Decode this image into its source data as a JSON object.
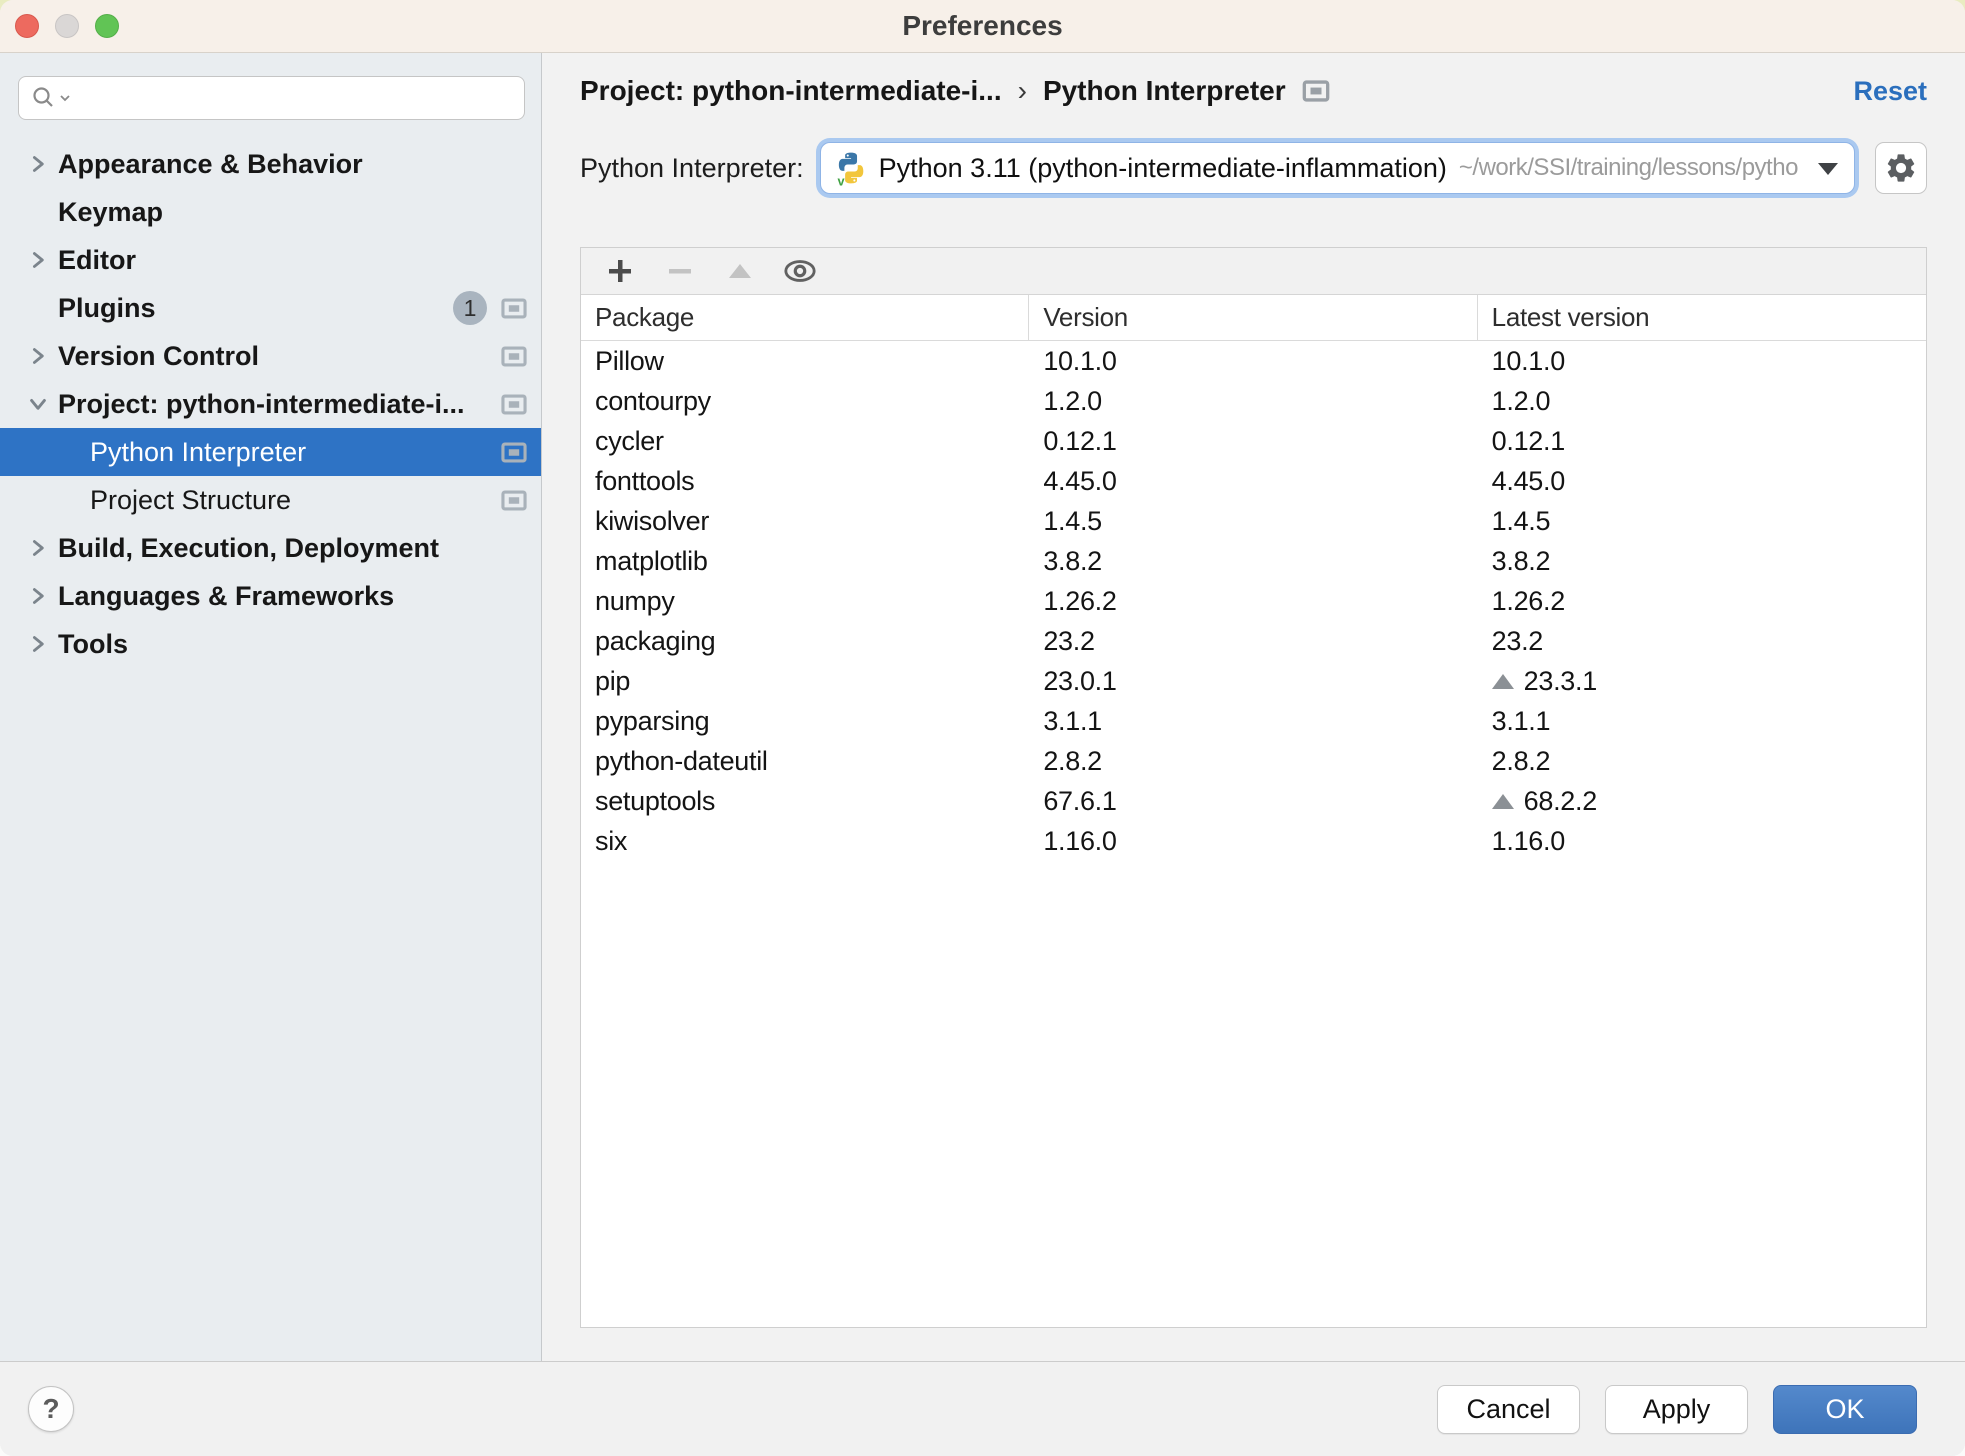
{
  "window": {
    "title": "Preferences"
  },
  "sidebar": {
    "search": {
      "placeholder": ""
    },
    "items": [
      {
        "label": "Appearance & Behavior",
        "chevron": "right",
        "level": 0,
        "bold": true,
        "selected": false,
        "badge": null,
        "marker": false
      },
      {
        "label": "Keymap",
        "chevron": "none",
        "level": 0,
        "bold": true,
        "selected": false,
        "badge": null,
        "marker": false
      },
      {
        "label": "Editor",
        "chevron": "right",
        "level": 0,
        "bold": true,
        "selected": false,
        "badge": null,
        "marker": false
      },
      {
        "label": "Plugins",
        "chevron": "none",
        "level": 0,
        "bold": true,
        "selected": false,
        "badge": "1",
        "marker": true
      },
      {
        "label": "Version Control",
        "chevron": "right",
        "level": 0,
        "bold": true,
        "selected": false,
        "badge": null,
        "marker": true
      },
      {
        "label": "Project: python-intermediate-i...",
        "chevron": "down",
        "level": 0,
        "bold": true,
        "selected": false,
        "badge": null,
        "marker": true
      },
      {
        "label": "Python Interpreter",
        "chevron": "none",
        "level": 1,
        "bold": false,
        "selected": true,
        "badge": null,
        "marker": true
      },
      {
        "label": "Project Structure",
        "chevron": "none",
        "level": 1,
        "bold": false,
        "selected": false,
        "badge": null,
        "marker": true
      },
      {
        "label": "Build, Execution, Deployment",
        "chevron": "right",
        "level": 0,
        "bold": true,
        "selected": false,
        "badge": null,
        "marker": false
      },
      {
        "label": "Languages & Frameworks",
        "chevron": "right",
        "level": 0,
        "bold": true,
        "selected": false,
        "badge": null,
        "marker": false
      },
      {
        "label": "Tools",
        "chevron": "right",
        "level": 0,
        "bold": true,
        "selected": false,
        "badge": null,
        "marker": false
      }
    ]
  },
  "header": {
    "breadcrumb_project": "Project: python-intermediate-i...",
    "breadcrumb_separator": "›",
    "breadcrumb_page": "Python Interpreter",
    "reset_label": "Reset"
  },
  "interpreter": {
    "label": "Python Interpreter:",
    "value": "Python 3.11 (python-intermediate-inflammation)",
    "path": "~/work/SSI/training/lessons/pytho"
  },
  "packages": {
    "columns": [
      "Package",
      "Version",
      "Latest version"
    ],
    "toolbar_icons": [
      "plus-icon",
      "minus-icon",
      "upgrade-icon",
      "eye-icon"
    ],
    "rows": [
      {
        "name": "Pillow",
        "version": "10.1.0",
        "latest": "10.1.0",
        "upgrade": false
      },
      {
        "name": "contourpy",
        "version": "1.2.0",
        "latest": "1.2.0",
        "upgrade": false
      },
      {
        "name": "cycler",
        "version": "0.12.1",
        "latest": "0.12.1",
        "upgrade": false
      },
      {
        "name": "fonttools",
        "version": "4.45.0",
        "latest": "4.45.0",
        "upgrade": false
      },
      {
        "name": "kiwisolver",
        "version": "1.4.5",
        "latest": "1.4.5",
        "upgrade": false
      },
      {
        "name": "matplotlib",
        "version": "3.8.2",
        "latest": "3.8.2",
        "upgrade": false
      },
      {
        "name": "numpy",
        "version": "1.26.2",
        "latest": "1.26.2",
        "upgrade": false
      },
      {
        "name": "packaging",
        "version": "23.2",
        "latest": "23.2",
        "upgrade": false
      },
      {
        "name": "pip",
        "version": "23.0.1",
        "latest": "23.3.1",
        "upgrade": true
      },
      {
        "name": "pyparsing",
        "version": "3.1.1",
        "latest": "3.1.1",
        "upgrade": false
      },
      {
        "name": "python-dateutil",
        "version": "2.8.2",
        "latest": "2.8.2",
        "upgrade": false
      },
      {
        "name": "setuptools",
        "version": "67.6.1",
        "latest": "68.2.2",
        "upgrade": true
      },
      {
        "name": "six",
        "version": "1.16.0",
        "latest": "1.16.0",
        "upgrade": false
      }
    ]
  },
  "footer": {
    "help_label": "?",
    "cancel_label": "Cancel",
    "apply_label": "Apply",
    "ok_label": "OK"
  },
  "colors": {
    "titlebar_bg": "#f7f0e9",
    "sidebar_bg": "#e9edf0",
    "selection_blue": "#2e73c5",
    "content_bg": "#f2f2f2",
    "reset_link_blue": "#2b6fbd",
    "ok_button_blue": "#3e74ba",
    "focus_ring_blue": "#aac9f0",
    "upgrade_arrow_gray": "#8b9095",
    "traffic_red": "#ed6a5f",
    "traffic_gray": "#dad7d6",
    "traffic_green": "#61c455"
  }
}
